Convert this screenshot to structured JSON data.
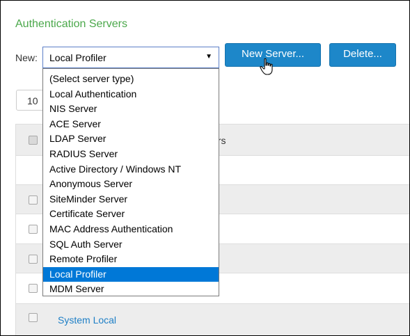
{
  "panel": {
    "title": "Authentication Servers",
    "new_label": "New:",
    "selected_server_type": "Local Profiler",
    "new_button_label": "New Server...",
    "delete_button_label": "Delete...",
    "per_page_value": "10"
  },
  "dropdown": {
    "options": [
      "(Select server type)",
      "Local Authentication",
      "NIS Server",
      "ACE Server",
      "LDAP Server",
      "RADIUS Server",
      "Active Directory / Windows NT",
      "Anonymous Server",
      "SiteMinder Server",
      "Certificate Server",
      "MAC Address Authentication",
      "SQL Auth Server",
      "Remote Profiler",
      "Local Profiler",
      "MDM Server"
    ],
    "selected_option": "Local Profiler"
  },
  "table": {
    "header_visible_text": "vers",
    "last_row_link": "System Local"
  },
  "colors": {
    "title": "#4ba84b",
    "button": "#1d87c9",
    "link": "#1e7fc6",
    "selection": "#0078d7"
  },
  "icons": {
    "cursor": "hand-pointer-icon",
    "dropdown_arrow": "triangle-down-icon",
    "checkbox": "checkbox-icon"
  }
}
